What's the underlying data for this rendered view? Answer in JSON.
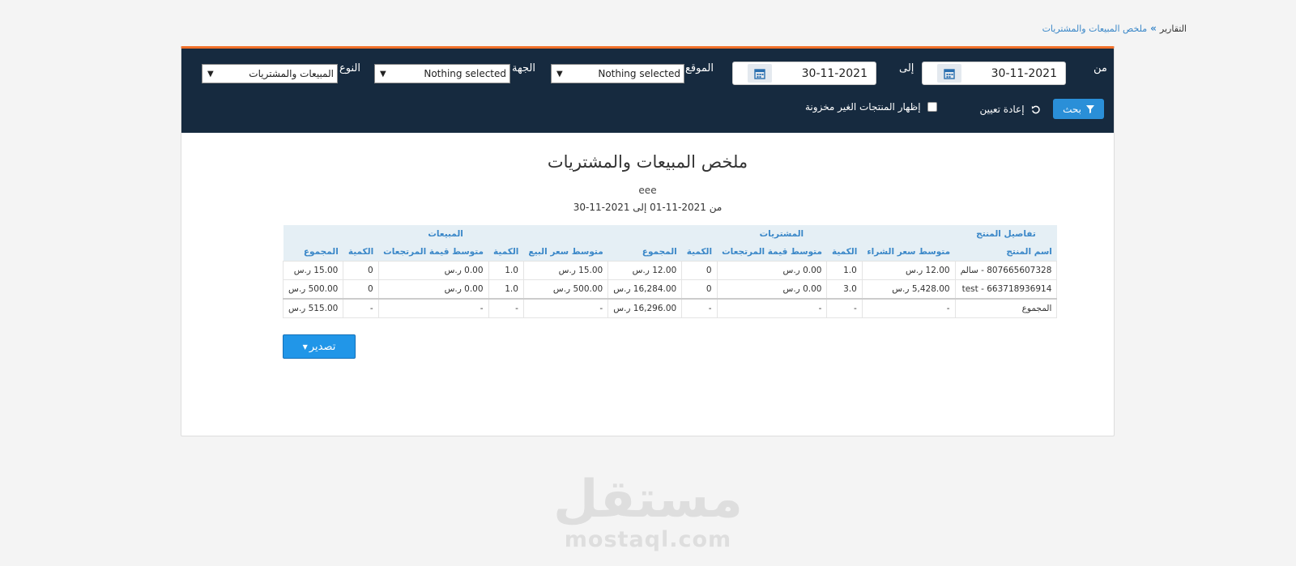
{
  "breadcrumb": {
    "home": "التقارير",
    "separator": "»",
    "current": "ملخص المبيعات والمشتريات"
  },
  "filters": {
    "from_label": "من",
    "from_value": "30-11-2021",
    "to_label": "إلى",
    "to_value": "30-11-2021",
    "location_label": "الموقع",
    "location_value": "Nothing selected",
    "party_label": "الجهة",
    "party_value": "Nothing selected",
    "type_label": "النوع",
    "type_value": "المبيعات والمشتريات",
    "search_label": "بحث",
    "reset_label": "إعادة تعيين",
    "show_non_stock_label": "إظهار المنتجات الغير مخزونة",
    "show_non_stock_checked": false
  },
  "report": {
    "title": "ملخص المبيعات والمشتريات",
    "subtitle": "eee",
    "range": "من 2021-11-01 إلى 2021-11-30",
    "groups": {
      "product": "تفاصيل المنتج",
      "purchases": "المشتريات",
      "sales": "المبيعات"
    },
    "columns": {
      "product_name": "اسم المنتج",
      "p_avg_price": "متوسط سعر الشراء",
      "p_qty": "الكمية",
      "p_avg_return": "متوسط قيمة المرتجعات",
      "p_ret_qty": "الكمية",
      "p_total": "المجموع",
      "s_avg_price": "متوسط سعر البيع",
      "s_qty": "الكمية",
      "s_avg_return": "متوسط قيمة المرتجعات",
      "s_ret_qty": "الكمية",
      "s_total": "المجموع"
    },
    "rows": [
      [
        "807665607328 - سالم",
        "12.00 ر.س",
        "1.0",
        "0.00 ر.س",
        "0",
        "12.00 ر.س",
        "15.00 ر.س",
        "1.0",
        "0.00 ر.س",
        "0",
        "15.00 ر.س"
      ],
      [
        "test - 663718936914",
        "5,428.00 ر.س",
        "3.0",
        "0.00 ر.س",
        "0",
        "16,284.00 ر.س",
        "500.00 ر.س",
        "1.0",
        "0.00 ر.س",
        "0",
        "500.00 ر.س"
      ]
    ],
    "total_row": [
      "المجموع",
      "-",
      "-",
      "-",
      "-",
      "16,296.00 ر.س",
      "-",
      "-",
      "-",
      "-",
      "515.00 ر.س"
    ]
  },
  "export_label": "تصدير",
  "watermark": {
    "arabic": "مستقل",
    "latin": "mostaql.com"
  },
  "colors": {
    "accent_top": "#f0702a",
    "filter_bg": "#162a3f",
    "primary": "#2a8fd8",
    "header_text": "#3a87c8"
  }
}
